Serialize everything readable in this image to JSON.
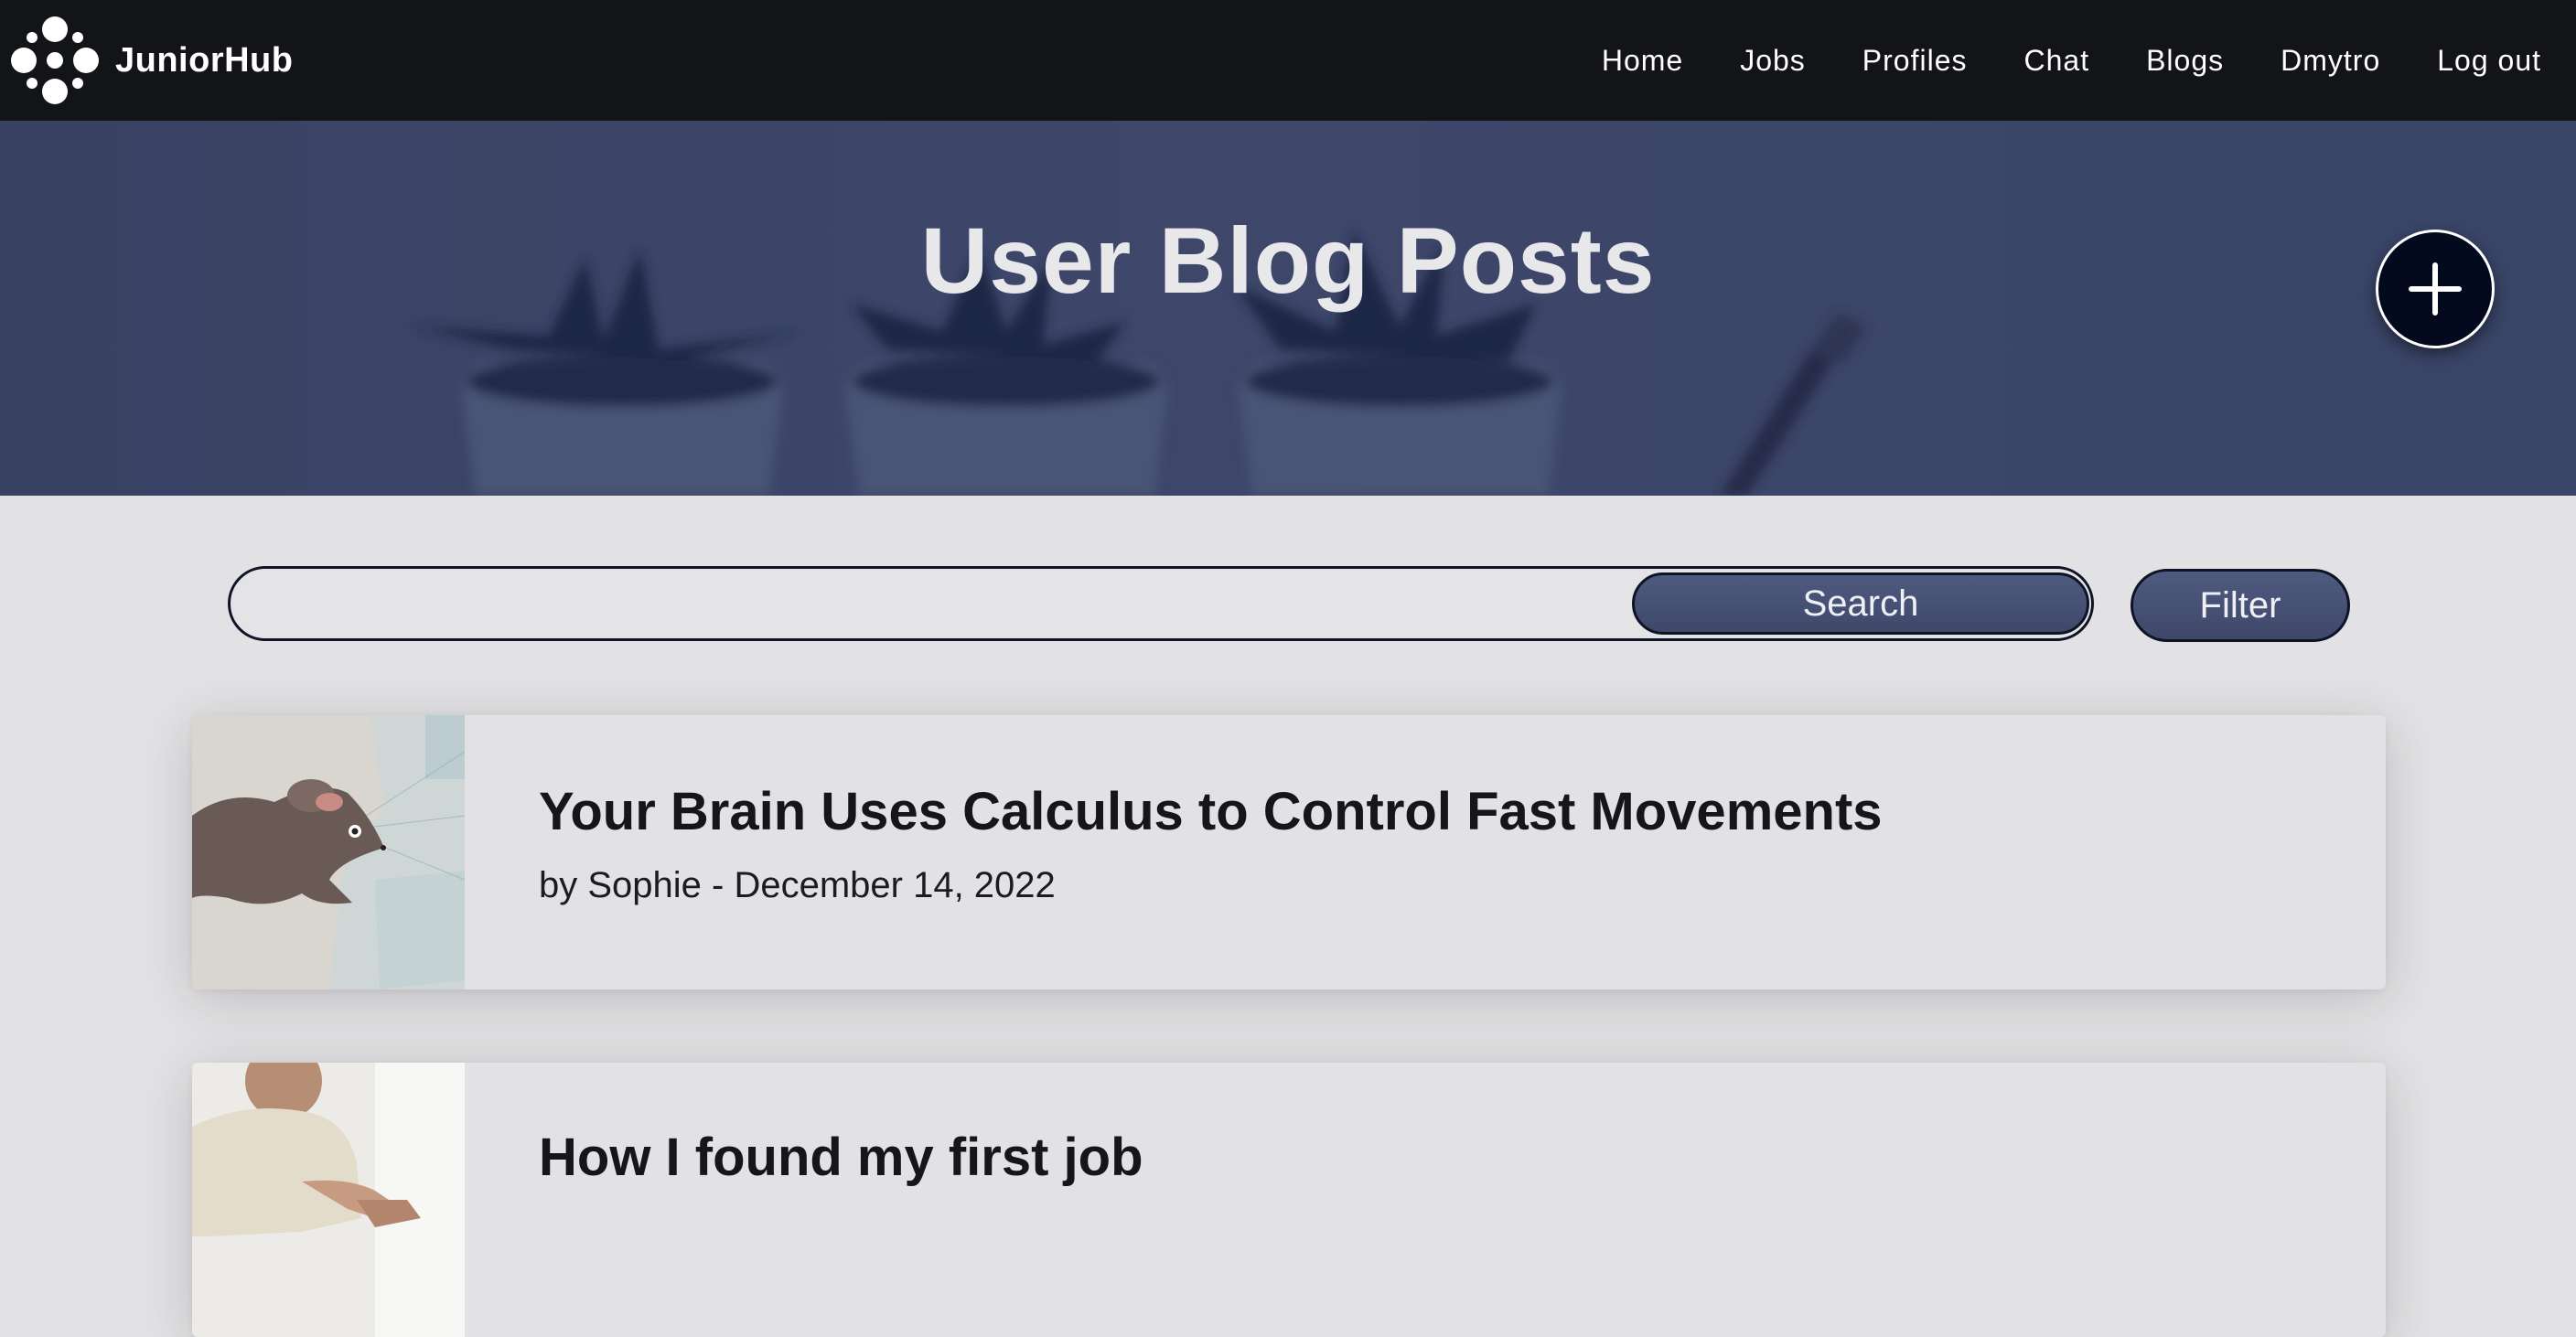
{
  "brand": {
    "name": "JuniorHub",
    "logo_icon": "dots-cluster-logo"
  },
  "nav": {
    "items": [
      {
        "label": "Home"
      },
      {
        "label": "Jobs"
      },
      {
        "label": "Profiles"
      },
      {
        "label": "Chat"
      },
      {
        "label": "Blogs"
      },
      {
        "label": "Dmytro"
      },
      {
        "label": "Log out"
      }
    ]
  },
  "hero": {
    "title": "User Blog Posts",
    "add_button_icon": "plus-icon"
  },
  "search": {
    "value": "",
    "placeholder": "",
    "button_label": "Search"
  },
  "filter": {
    "label": "Filter"
  },
  "posts": [
    {
      "title": "Your Brain Uses Calculus to Control Fast Movements",
      "meta": "by Sophie - December 14, 2022",
      "thumbnail": "mouse-illustration"
    },
    {
      "title": "How I found my first job",
      "meta": "",
      "thumbnail": "handshake-photo"
    }
  ],
  "colors": {
    "navbar": "#131418",
    "hero_overlay": "#3b4466",
    "page_background": "#e2e2e4",
    "button_fill": "#4a5479",
    "add_button": "#040a1d"
  }
}
